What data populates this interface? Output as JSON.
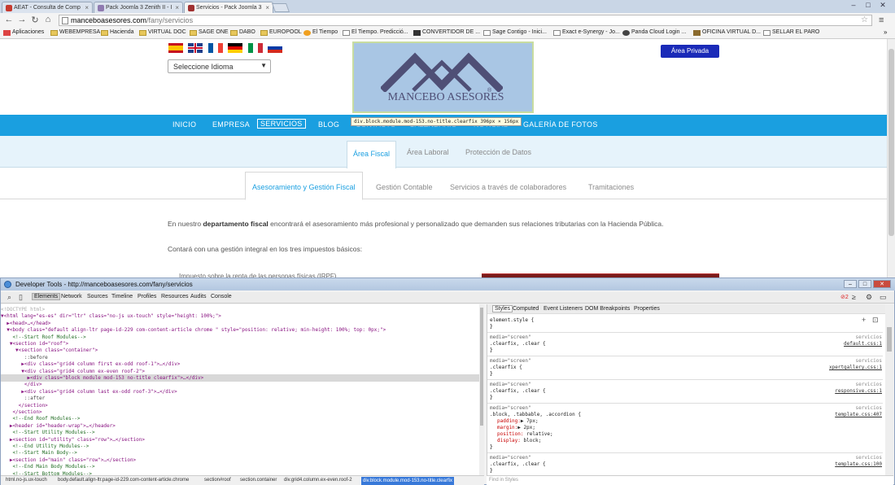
{
  "browser": {
    "tabs": [
      {
        "title": "AEAT - Consulta de Comp"
      },
      {
        "title": "Pack Joomla 3 Zenith II - I"
      },
      {
        "title": "Servicios - Pack Joomla 3"
      }
    ],
    "url_host": "manceboasesores.com",
    "url_path": "/fany/servicios",
    "bookmarks": [
      "Aplicaciones",
      "WEBEMPRESA",
      "Hacienda",
      "VIRTUAL DOC",
      "SAGE ONE",
      "DABO",
      "EUROPOOL",
      "El Tiempo",
      "El Tiempo. Predicció...",
      "CONVERTIDOR DE ...",
      "Sage Contigo - Inici...",
      "Exact e-Synergy - Jo...",
      "Panda Cloud Login ...",
      "OFICINA VIRTUAL D...",
      "SELLAR EL PARO"
    ]
  },
  "site": {
    "language_select": "Seleccione Idioma",
    "logo_text": "MANCEBO ASESORES",
    "logo_mark": "®",
    "area_privada": "Área Privada",
    "inspect_tooltip": "div.block.module.mod-153.no-title.clearfix 396px × 156px",
    "nav": [
      "INICIO",
      "EMPRESA",
      "SERVICIOS",
      "BLOG",
      "CONTACTO",
      "CALENDARIO",
      "NOTICIAS",
      "GALERÍA DE FOTOS"
    ],
    "nav_visible": {
      "contacto": "CONTACTO",
      "calendario": "CALENDARIO",
      "noticias": "NOTICIAS"
    },
    "nav_last": "GALERÍA DE FOTOS",
    "area_tabs": [
      "Área Fiscal",
      "Área Laboral",
      "Protección de Datos"
    ],
    "service_tabs": [
      "Asesoramiento y Gestión Fiscal",
      "Gestión Contable",
      "Servicios a través de colaboradores",
      "Tramitaciones"
    ],
    "para1_pre": "En nuestro ",
    "para1_bold": "departamento fiscal",
    "para1_post": " encontrará el asesoramiento más profesional y personalizado que demanden sus relaciones tributarias con la Hacienda Pública.",
    "para2": "Contará con una gestión integral en los tres impuestos básicos:",
    "cut_line": "Impuesto sobre la renta de las personas físicas (IRPF)"
  },
  "devtools": {
    "title": "Developer Tools - http://manceboasesores.com/fany/servicios",
    "tabs": [
      "Elements",
      "Network",
      "Sources",
      "Timeline",
      "Profiles",
      "Resources",
      "Audits",
      "Console"
    ],
    "error_count": "2",
    "style_tabs": [
      "Styles",
      "Computed",
      "Event Listeners",
      "DOM Breakpoints",
      "Properties"
    ],
    "find_placeholder": "Find in Styles",
    "breadcrumbs": [
      "html.no-js.ux-touch",
      "body.default.align-ltr.page-id-229.com-content-article.chrome",
      "section#roof",
      "section.container",
      "div.grid4.column.ex-even.roof-2",
      "div.block.module.mod-153.no-title.clearfix"
    ],
    "dom_lines": [
      {
        "t": "<!DOCTYPE html>",
        "c": "c-doc"
      },
      {
        "t": "▼<html lang=\"es-es\" dir=\"ltr\" class=\"no-js ux-touch\" style=\"height: 100%;\">",
        "c": "c-tag"
      },
      {
        "t": "  ▶<head>…</head>",
        "c": "c-tag"
      },
      {
        "t": "  ▼<body class=\"default align-ltr page-id-229 com-content-article chrome \" style=\"position: relative; min-height: 100%; top: 0px;\">",
        "c": "c-tag"
      },
      {
        "t": "    <!--Start Roof Modules-->",
        "c": "c-com"
      },
      {
        "t": "   ▼<section id=\"roof\">",
        "c": "c-tag"
      },
      {
        "t": "     ▼<section class=\"container\">",
        "c": "c-tag"
      },
      {
        "t": "        ::before",
        "c": "c-pl"
      },
      {
        "t": "       ▶<div class=\"grid4 column first ex-odd roof-1\">…</div>",
        "c": "c-tag"
      },
      {
        "t": "       ▼<div class=\"grid4 column ex-even roof-2\">",
        "c": "c-tag"
      },
      {
        "t": "         ▶<div class=\"block module mod-153 no-title clearfix\">…</div>",
        "c": "c-tag",
        "sel": true
      },
      {
        "t": "        </div>",
        "c": "c-tag"
      },
      {
        "t": "       ▶<div class=\"grid4 column last ex-odd roof-3\">…</div>",
        "c": "c-tag"
      },
      {
        "t": "        ::after",
        "c": "c-pl"
      },
      {
        "t": "      </section>",
        "c": "c-tag"
      },
      {
        "t": "    </section>",
        "c": "c-tag"
      },
      {
        "t": "    <!--End Roof Modules-->",
        "c": "c-com"
      },
      {
        "t": "   ▶<header id=\"header-wrap\">…</header>",
        "c": "c-tag"
      },
      {
        "t": "    <!--Start Utility Modules-->",
        "c": "c-com"
      },
      {
        "t": "   ▶<section id=\"utility\" class=\"row\">…</section>",
        "c": "c-tag"
      },
      {
        "t": "    <!--End Utility Modules-->",
        "c": "c-com"
      },
      {
        "t": "    <!--Start Main Body-->",
        "c": "c-com"
      },
      {
        "t": "   ▶<section id=\"main\" class=\"row\">…</section>",
        "c": "c-tag"
      },
      {
        "t": "    <!--End Main Body Modules-->",
        "c": "c-com"
      },
      {
        "t": "    <!--Start Bottom Modules-->",
        "c": "c-com"
      }
    ],
    "style_rules": [
      {
        "media": "",
        "sel": "element.style {",
        "src": "",
        "props": []
      },
      {
        "media": "media=\"screen\"",
        "sel": ".clearfix, .clear {",
        "src": "default.css:1",
        "props": []
      },
      {
        "media": "media=\"screen\"",
        "sel": ".clearfix {",
        "src": "xpertgallery.css:1",
        "props": []
      },
      {
        "media": "media=\"screen\"",
        "sel": ".clearfix, .clear {",
        "src": "responsive.css:1",
        "props": []
      },
      {
        "media": "media=\"screen\"",
        "sel": ".block, .tabbable, .accordion {",
        "src": "template.css:407",
        "props": [
          {
            "n": "padding",
            "v": "▶ 7px;"
          },
          {
            "n": "margin",
            "v": "▶ 2px;"
          },
          {
            "n": "position",
            "v": " relative;"
          },
          {
            "n": "display",
            "v": " block;"
          }
        ]
      },
      {
        "media": "media=\"screen\"",
        "sel": ".clearfix, .clear {",
        "src": "template.css:100",
        "props": []
      }
    ],
    "style_media_src": "servicios"
  },
  "colors": {
    "nav_blue": "#1a9fe0",
    "private_btn": "#1a2ab8",
    "logo_bg": "#a9c6e4"
  }
}
